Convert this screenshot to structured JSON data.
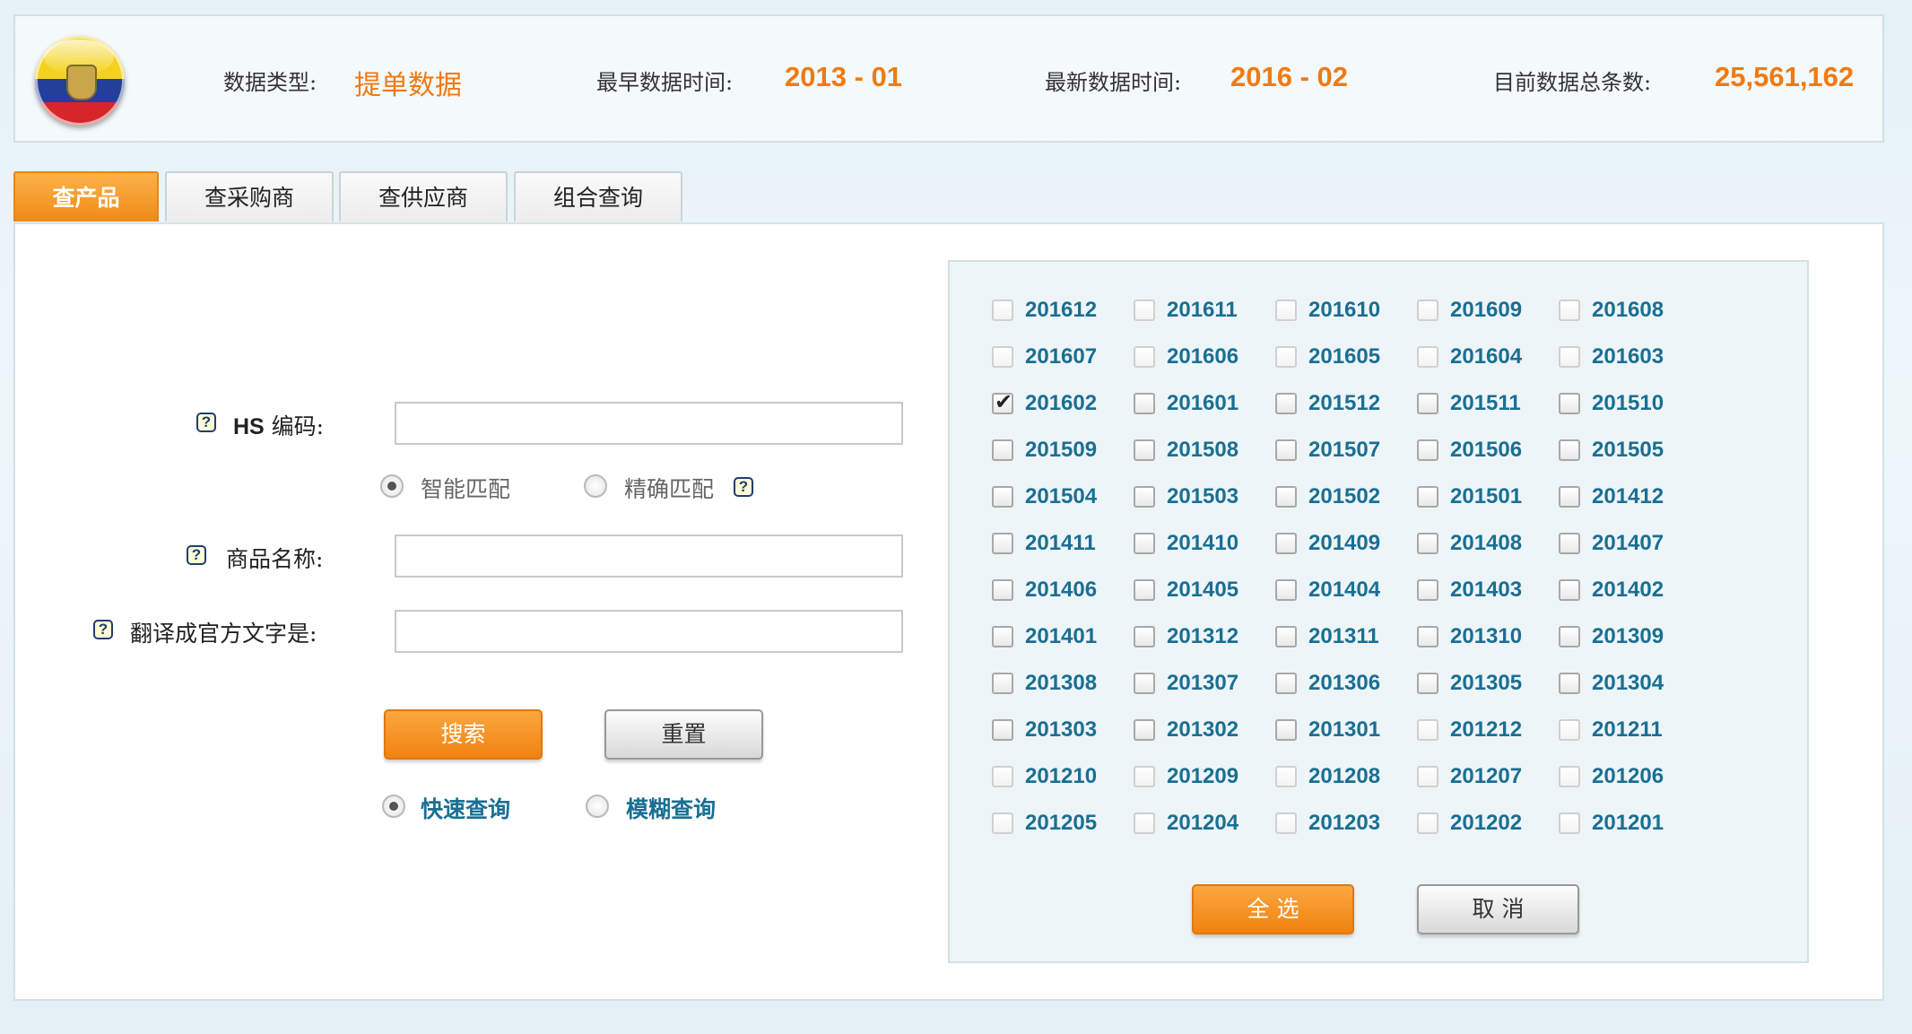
{
  "header": {
    "data_type_label": "数据类型:",
    "data_type_value": "提单数据",
    "earliest_label": "最早数据时间:",
    "earliest_value": "2013 - 01",
    "latest_label": "最新数据时间:",
    "latest_value": "2016 - 02",
    "total_label": "目前数据总条数:",
    "total_value": "25,561,162"
  },
  "tabs": [
    {
      "label": "查产品",
      "active": true
    },
    {
      "label": "查采购商",
      "active": false
    },
    {
      "label": "查供应商",
      "active": false
    },
    {
      "label": "组合查询",
      "active": false
    }
  ],
  "form": {
    "hs_label_prefix": "HS",
    "hs_label_suffix": " 编码:",
    "hs_value": "",
    "match_smart": "智能匹配",
    "match_exact": "精确匹配",
    "product_label": "商品名称:",
    "product_value": "",
    "translate_label": "翻译成官方文字是:",
    "translate_value": "",
    "search_button": "搜索",
    "reset_button": "重置",
    "mode_fast": "快速查询",
    "mode_fuzzy": "模糊查询",
    "help_icon": "?"
  },
  "months": [
    [
      "201612",
      "201611",
      "201610",
      "201609",
      "201608"
    ],
    [
      "201607",
      "201606",
      "201605",
      "201604",
      "201603"
    ],
    [
      "201602",
      "201601",
      "201512",
      "201511",
      "201510"
    ],
    [
      "201509",
      "201508",
      "201507",
      "201506",
      "201505"
    ],
    [
      "201504",
      "201503",
      "201502",
      "201501",
      "201412"
    ],
    [
      "201411",
      "201410",
      "201409",
      "201408",
      "201407"
    ],
    [
      "201406",
      "201405",
      "201404",
      "201403",
      "201402"
    ],
    [
      "201401",
      "201312",
      "201311",
      "201310",
      "201309"
    ],
    [
      "201308",
      "201307",
      "201306",
      "201305",
      "201304"
    ],
    [
      "201303",
      "201302",
      "201301",
      "201212",
      "201211"
    ],
    [
      "201210",
      "201209",
      "201208",
      "201207",
      "201206"
    ],
    [
      "201205",
      "201204",
      "201203",
      "201202",
      "201201"
    ]
  ],
  "checked_months": [
    "201602"
  ],
  "available_range": [
    "201301",
    "201602"
  ],
  "month_actions": {
    "select_all": "全 选",
    "cancel": "取 消"
  },
  "colors": {
    "accent_orange": "#f07a12",
    "link_blue": "#1a6f93"
  }
}
